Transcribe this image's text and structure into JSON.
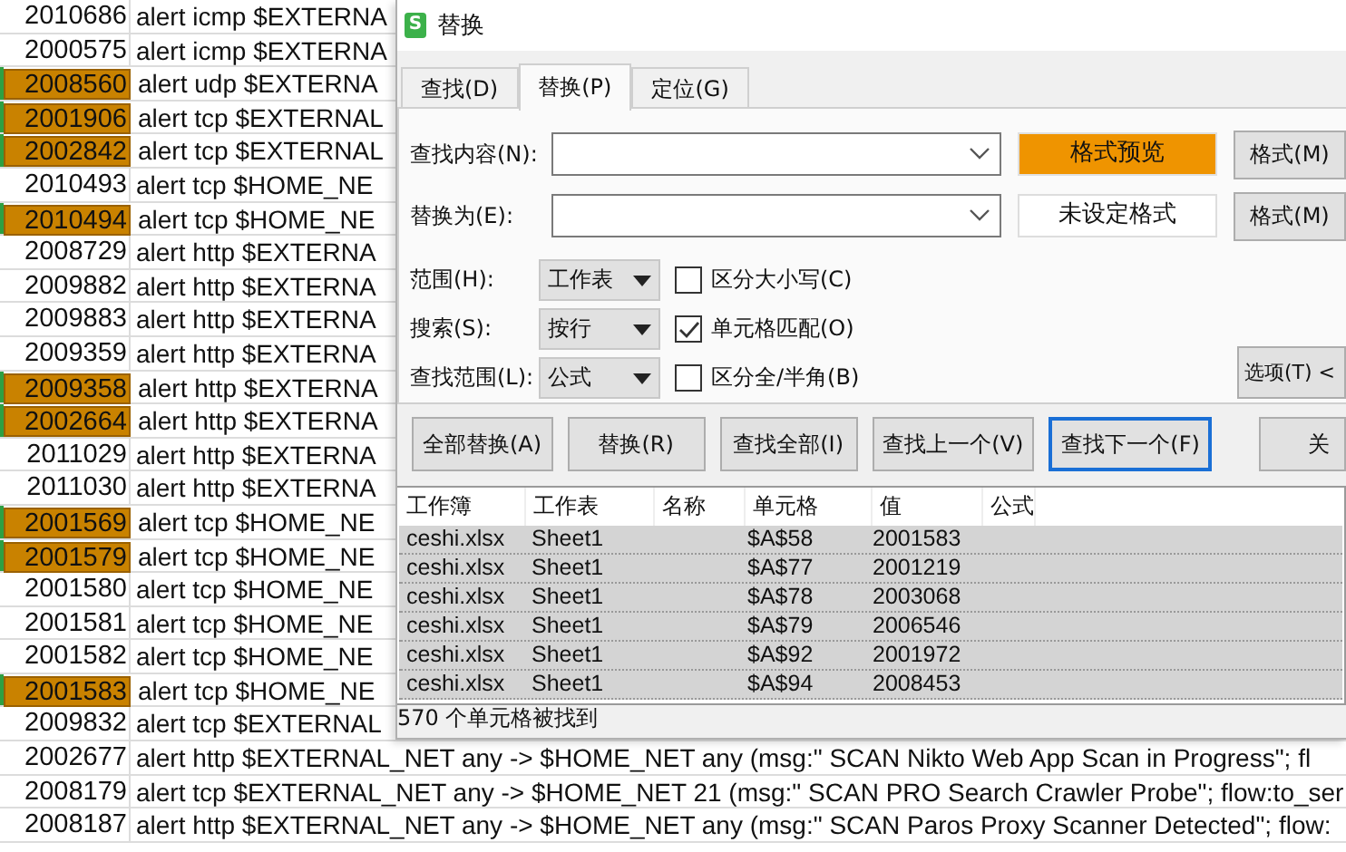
{
  "sheet": {
    "rows": [
      {
        "id": "2010686",
        "rule": "alert icmp $EXTERNA",
        "found": false
      },
      {
        "id": "2000575",
        "rule": "alert icmp $EXTERNA",
        "found": false
      },
      {
        "id": "2008560",
        "rule": "alert udp $EXTERNA",
        "found": true
      },
      {
        "id": "2001906",
        "rule": "alert tcp $EXTERNAL",
        "found": true
      },
      {
        "id": "2002842",
        "rule": "alert tcp $EXTERNAL",
        "found": true
      },
      {
        "id": "2010493",
        "rule": "alert tcp $HOME_NE",
        "found": false
      },
      {
        "id": "2010494",
        "rule": "alert tcp $HOME_NE",
        "found": true
      },
      {
        "id": "2008729",
        "rule": "alert http $EXTERNA",
        "found": false
      },
      {
        "id": "2009882",
        "rule": "alert http $EXTERNA",
        "found": false
      },
      {
        "id": "2009883",
        "rule": "alert http $EXTERNA",
        "found": false
      },
      {
        "id": "2009359",
        "rule": "alert http $EXTERNA",
        "found": false
      },
      {
        "id": "2009358",
        "rule": "alert http $EXTERNA",
        "found": true
      },
      {
        "id": "2002664",
        "rule": "alert http $EXTERNA",
        "found": true
      },
      {
        "id": "2011029",
        "rule": "alert http $EXTERNA",
        "found": false
      },
      {
        "id": "2011030",
        "rule": "alert http $EXTERNA",
        "found": false
      },
      {
        "id": "2001569",
        "rule": "alert tcp $HOME_NE",
        "found": true
      },
      {
        "id": "2001579",
        "rule": "alert tcp $HOME_NE",
        "found": true
      },
      {
        "id": "2001580",
        "rule": "alert tcp $HOME_NE",
        "found": false
      },
      {
        "id": "2001581",
        "rule": "alert tcp $HOME_NE",
        "found": false
      },
      {
        "id": "2001582",
        "rule": "alert tcp $HOME_NE",
        "found": false
      },
      {
        "id": "2001583",
        "rule": "alert tcp $HOME_NE",
        "found": true
      },
      {
        "id": "2009832",
        "rule": "alert tcp $EXTERNAL",
        "found": false
      },
      {
        "id": "2002677",
        "rule": "alert http $EXTERNAL_NET any -> $HOME_NET any (msg:\" SCAN Nikto Web App Scan in Progress\"; fl",
        "found": false
      },
      {
        "id": "2008179",
        "rule": "alert tcp $EXTERNAL_NET any -> $HOME_NET 21 (msg:\" SCAN PRO Search Crawler Probe\"; flow:to_ser",
        "found": false
      },
      {
        "id": "2008187",
        "rule": "alert http $EXTERNAL_NET any -> $HOME_NET any (msg:\" SCAN Paros Proxy Scanner Detected\"; flow:",
        "found": false
      }
    ]
  },
  "dialog": {
    "logo": "S",
    "title": "替换",
    "tabs": [
      {
        "label": "查找(D)",
        "selected": false
      },
      {
        "label": "替换(P)",
        "selected": true
      },
      {
        "label": "定位(G)",
        "selected": false
      }
    ],
    "fields": [
      {
        "label": "查找内容(N):",
        "preview": "格式预览",
        "preview_set": true,
        "format_button": "格式(M)"
      },
      {
        "label": "替换为(E):",
        "preview": "未设定格式",
        "preview_set": false,
        "format_button": "格式(M)"
      }
    ],
    "options": [
      {
        "label": "范围(H):",
        "value": "工作表",
        "checkbox": "区分大小写(C)",
        "checked": false
      },
      {
        "label": "搜索(S):",
        "value": "按行",
        "checkbox": "单元格匹配(O)",
        "checked": true
      },
      {
        "label": "查找范围(L):",
        "value": "公式",
        "checkbox": "区分全/半角(B)",
        "checked": false
      }
    ],
    "options_button": "选项(T) <",
    "actions": [
      {
        "label": "全部替换(A)",
        "focused": false
      },
      {
        "label": "替换(R)",
        "focused": false
      },
      {
        "label": "查找全部(I)",
        "focused": false
      },
      {
        "label": "查找上一个(V)",
        "focused": false
      },
      {
        "label": "查找下一个(F)",
        "focused": true
      },
      {
        "label": "关",
        "focused": false
      }
    ],
    "results": {
      "columns": [
        "工作簿",
        "工作表",
        "名称",
        "单元格",
        "值",
        "公式"
      ],
      "rows": [
        {
          "workbook": "ceshi.xlsx",
          "sheet": "Sheet1",
          "cell": "$A$58",
          "value": "2001583",
          "selected": true
        },
        {
          "workbook": "ceshi.xlsx",
          "sheet": "Sheet1",
          "cell": "$A$77",
          "value": "2001219",
          "selected": true
        },
        {
          "workbook": "ceshi.xlsx",
          "sheet": "Sheet1",
          "cell": "$A$78",
          "value": "2003068",
          "selected": true
        },
        {
          "workbook": "ceshi.xlsx",
          "sheet": "Sheet1",
          "cell": "$A$79",
          "value": "2006546",
          "selected": true
        },
        {
          "workbook": "ceshi.xlsx",
          "sheet": "Sheet1",
          "cell": "$A$92",
          "value": "2001972",
          "selected": true
        },
        {
          "workbook": "ceshi.xlsx",
          "sheet": "Sheet1",
          "cell": "$A$94",
          "value": "2008453",
          "selected": true
        }
      ]
    },
    "status": "570 个单元格被找到"
  }
}
